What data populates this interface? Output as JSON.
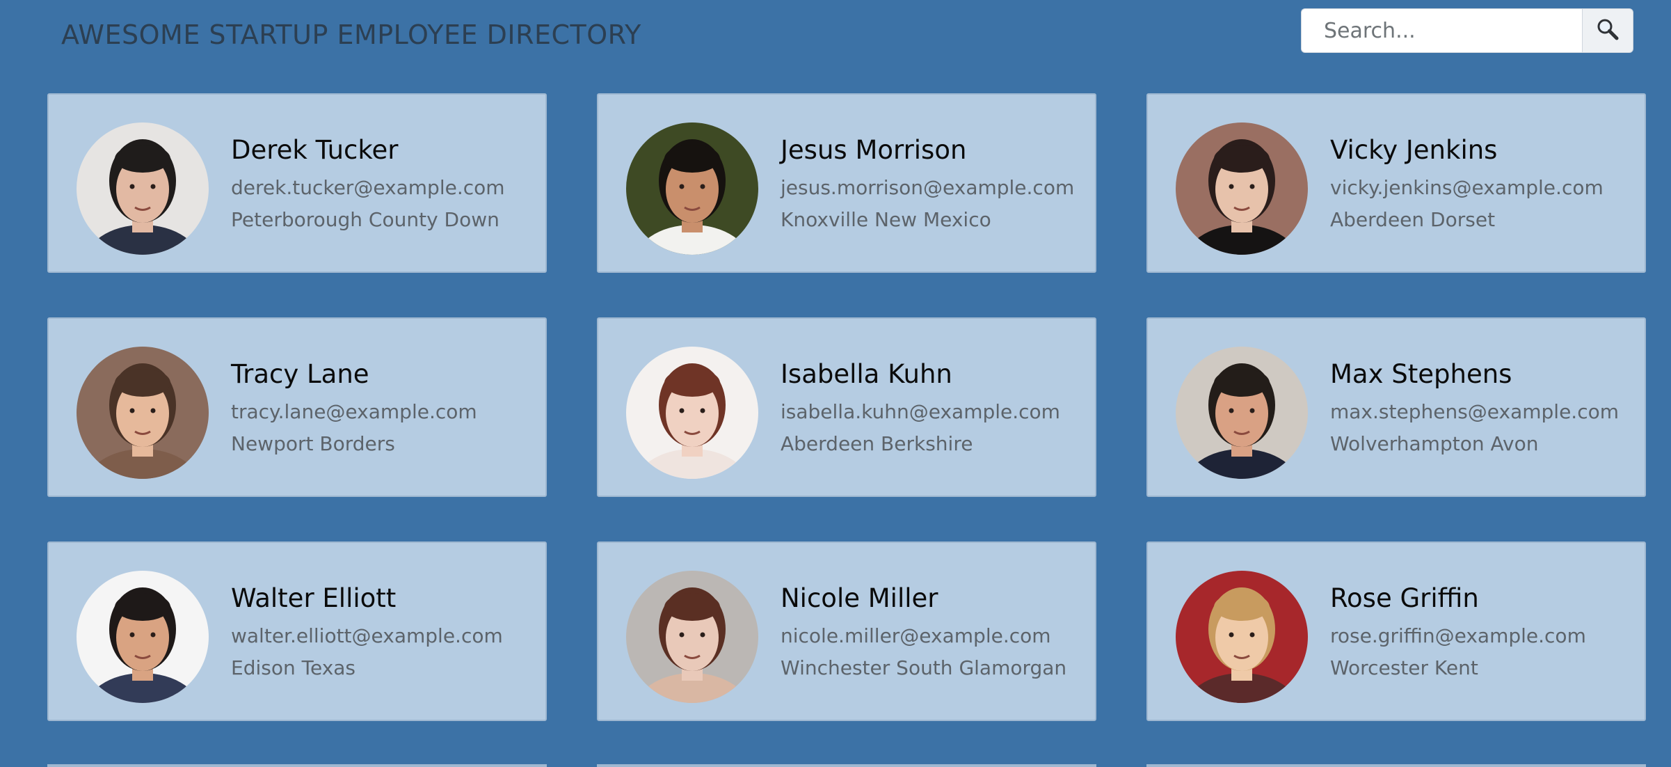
{
  "header": {
    "title": "AWESOME STARTUP EMPLOYEE DIRECTORY",
    "search_placeholder": "Search...",
    "search_icon": "search-icon"
  },
  "colors": {
    "background": "#3c72a6",
    "card": "#b5cce2",
    "card_border": "#9fb8d1"
  },
  "employees": [
    {
      "name": "Derek Tucker",
      "email": "derek.tucker@example.com",
      "location": "Peterborough County Down",
      "bg": "#e6e4e2",
      "skin": "#e2b9a3",
      "hair": "#1f1c1b",
      "shirt": "#2a3144"
    },
    {
      "name": "Jesus Morrison",
      "email": "jesus.morrison@example.com",
      "location": "Knoxville New Mexico",
      "bg": "#3e4a24",
      "skin": "#c98f6c",
      "hair": "#16120f",
      "shirt": "#f2f2ef"
    },
    {
      "name": "Vicky Jenkins",
      "email": "vicky.jenkins@example.com",
      "location": "Aberdeen Dorset",
      "bg": "#9a6f62",
      "skin": "#e7c2ab",
      "hair": "#2a1d1b",
      "shirt": "#151313"
    },
    {
      "name": "Tracy Lane",
      "email": "tracy.lane@example.com",
      "location": "Newport Borders",
      "bg": "#8a6b5c",
      "skin": "#e6b99b",
      "hair": "#4a3327",
      "shirt": "#7e5d4b"
    },
    {
      "name": "Isabella Kuhn",
      "email": "isabella.kuhn@example.com",
      "location": "Aberdeen Berkshire",
      "bg": "#f4f1ef",
      "skin": "#f0d1c2",
      "hair": "#6f3426",
      "shirt": "#efe4df"
    },
    {
      "name": "Max Stephens",
      "email": "max.stephens@example.com",
      "location": "Wolverhampton Avon",
      "bg": "#cfc9c2",
      "skin": "#d9a184",
      "hair": "#231d19",
      "shirt": "#1e2336"
    },
    {
      "name": "Walter Elliott",
      "email": "walter.elliott@example.com",
      "location": "Edison Texas",
      "bg": "#f5f5f5",
      "skin": "#d9a382",
      "hair": "#1e1918",
      "shirt": "#323b57"
    },
    {
      "name": "Nicole Miller",
      "email": "nicole.miller@example.com",
      "location": "Winchester South Glamorgan",
      "bg": "#bbb7b4",
      "skin": "#e9c9b9",
      "hair": "#5a2f23",
      "shirt": "#d9b7a3"
    },
    {
      "name": "Rose Griffin",
      "email": "rose.griffin@example.com",
      "location": "Worcester Kent",
      "bg": "#a7272b",
      "skin": "#efcaa8",
      "hair": "#c89b5f",
      "shirt": "#5b2a2a"
    }
  ]
}
